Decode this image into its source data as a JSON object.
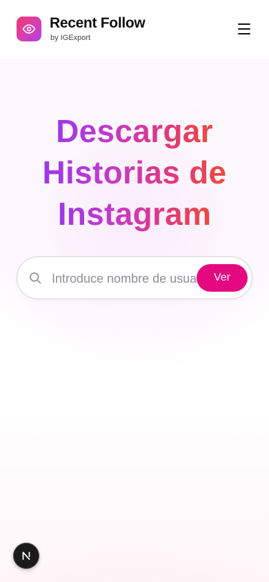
{
  "brand": {
    "title": "Recent Follow",
    "subtitle": "by IGExport",
    "logo_icon": "eye-icon",
    "gradient_colors": [
      "#f0386b",
      "#d63fb3",
      "#b33de0"
    ]
  },
  "header": {
    "menu_icon": "hamburger-menu-icon"
  },
  "hero": {
    "title_lines": [
      "Descargar",
      "Historias de",
      "Instagram"
    ],
    "gradient_colors": [
      "#9c38e8",
      "#c23bc9",
      "#e0387f",
      "#ee4a3b"
    ]
  },
  "search": {
    "icon": "search-icon",
    "placeholder": "Introduce nombre de usuario",
    "value": "",
    "button_label": "Ver",
    "button_color": "#e5097f"
  },
  "dev_badge": {
    "icon": "nextjs-n-icon"
  }
}
